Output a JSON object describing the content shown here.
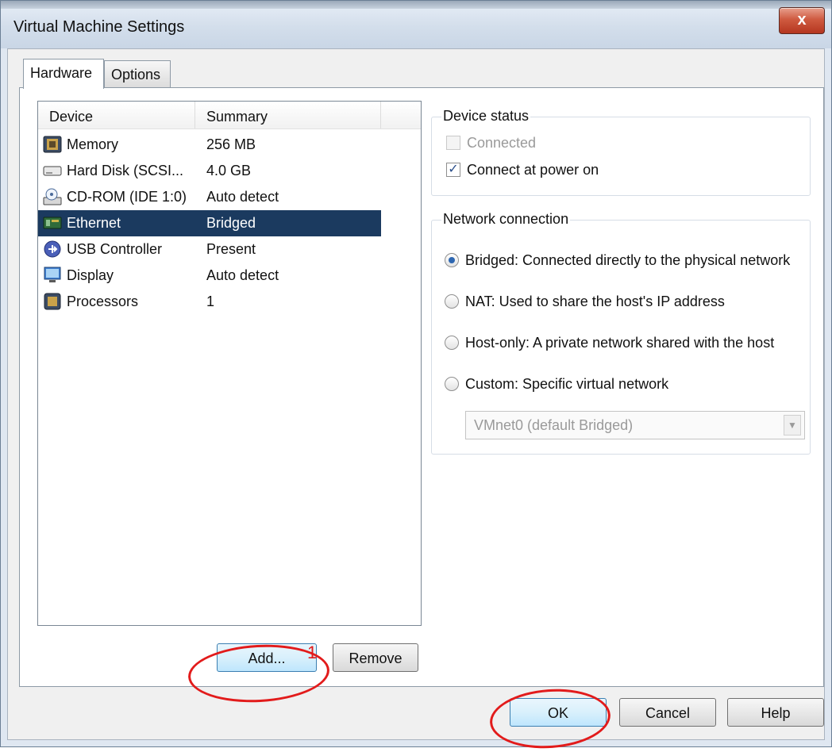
{
  "window": {
    "title": "Virtual Machine Settings",
    "close_glyph": "x"
  },
  "tabs": [
    {
      "label": "Hardware",
      "active": true
    },
    {
      "label": "Options",
      "active": false
    }
  ],
  "device_list": {
    "headers": [
      "Device",
      "Summary"
    ],
    "rows": [
      {
        "device": "Memory",
        "summary": "256 MB",
        "icon": "memory-icon",
        "selected": false
      },
      {
        "device": "Hard Disk (SCSI...",
        "summary": "4.0 GB",
        "icon": "hard-disk-icon",
        "selected": false
      },
      {
        "device": "CD-ROM (IDE 1:0)",
        "summary": "Auto detect",
        "icon": "cdrom-icon",
        "selected": false
      },
      {
        "device": "Ethernet",
        "summary": "Bridged",
        "icon": "ethernet-icon",
        "selected": true
      },
      {
        "device": "USB Controller",
        "summary": "Present",
        "icon": "usb-icon",
        "selected": false
      },
      {
        "device": "Display",
        "summary": "Auto detect",
        "icon": "display-icon",
        "selected": false
      },
      {
        "device": "Processors",
        "summary": "1",
        "icon": "processor-icon",
        "selected": false
      }
    ]
  },
  "device_status": {
    "legend": "Device status",
    "connected": {
      "label": "Connected",
      "checked": false,
      "disabled": true
    },
    "connect_at_power_on": {
      "label": "Connect at power on",
      "checked": true,
      "disabled": false
    }
  },
  "network_connection": {
    "legend": "Network connection",
    "options": [
      {
        "label": "Bridged: Connected directly to the physical network",
        "selected": true
      },
      {
        "label": "NAT: Used to share the host's IP address",
        "selected": false
      },
      {
        "label": "Host-only: A private network shared with the host",
        "selected": false
      },
      {
        "label": "Custom: Specific virtual network",
        "selected": false
      }
    ],
    "custom_network_select": "VMnet0 (default Bridged)"
  },
  "buttons": {
    "add": "Add...",
    "remove": "Remove",
    "ok": "OK",
    "cancel": "Cancel",
    "help": "Help"
  },
  "annotation": {
    "step_number": "1",
    "color": "#e21b1b"
  },
  "colors": {
    "selection": "#1b3a5f",
    "close_button": "#c5432b"
  }
}
